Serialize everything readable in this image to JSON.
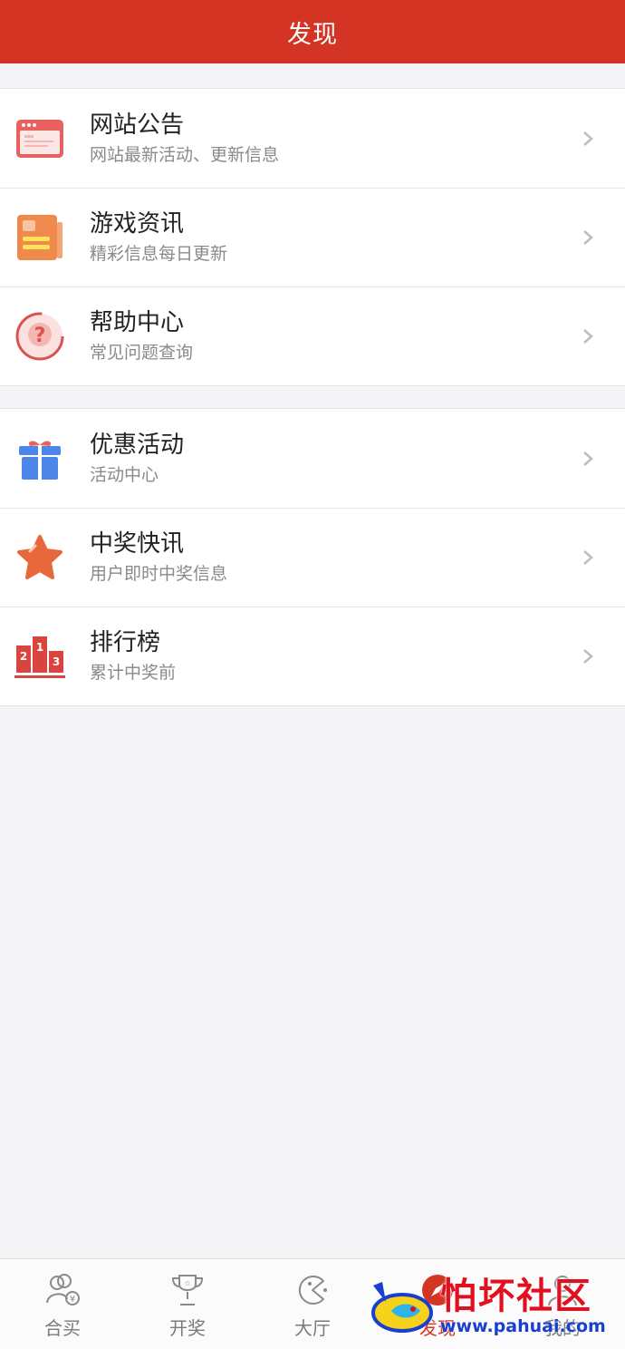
{
  "header": {
    "title": "发现"
  },
  "groups": [
    {
      "items": [
        {
          "label": "网站公告",
          "sub": "网站最新活动、更新信息",
          "icon": "announcement-icon"
        },
        {
          "label": "游戏资讯",
          "sub": "精彩信息每日更新",
          "icon": "news-icon"
        },
        {
          "label": "帮助中心",
          "sub": "常见问题查询",
          "icon": "help-icon"
        }
      ]
    },
    {
      "items": [
        {
          "label": "优惠活动",
          "sub": "活动中心",
          "icon": "gift-icon"
        },
        {
          "label": "中奖快讯",
          "sub": "用户即时中奖信息",
          "icon": "star-icon"
        },
        {
          "label": "排行榜",
          "sub": "累计中奖前",
          "icon": "podium-icon"
        }
      ]
    }
  ],
  "tabbar": {
    "tabs": [
      {
        "label": "合买",
        "icon": "group-buy-icon"
      },
      {
        "label": "开奖",
        "icon": "trophy-icon"
      },
      {
        "label": "大厅",
        "icon": "lobby-icon"
      },
      {
        "label": "发现",
        "icon": "discover-icon",
        "active": true
      },
      {
        "label": "我的",
        "icon": "profile-icon"
      }
    ]
  },
  "watermark": {
    "text": "怕坏社区",
    "url": "www.pahuai.com"
  },
  "colors": {
    "accent": "#d33424",
    "background": "#f4f4f6"
  }
}
